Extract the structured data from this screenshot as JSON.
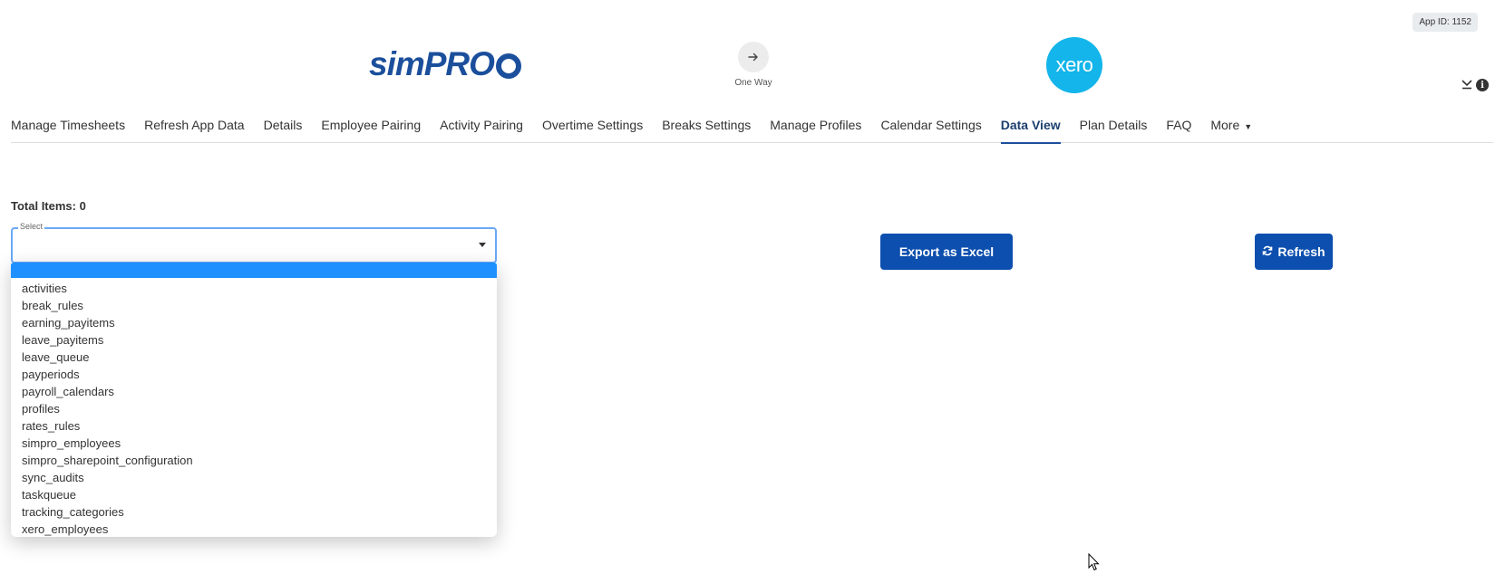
{
  "header": {
    "app_id": "App ID: 1152",
    "source_logo": "simPRO",
    "sync_direction_icon": "arrow-right-icon",
    "sync_direction_label": "One Way",
    "target_logo": "xero"
  },
  "corner_icons": [
    "collapse-icon",
    "info-icon"
  ],
  "nav": {
    "items": [
      {
        "label": "Manage Timesheets"
      },
      {
        "label": "Refresh App Data"
      },
      {
        "label": "Details"
      },
      {
        "label": "Employee Pairing"
      },
      {
        "label": "Activity Pairing"
      },
      {
        "label": "Overtime Settings"
      },
      {
        "label": "Breaks Settings"
      },
      {
        "label": "Manage Profiles"
      },
      {
        "label": "Calendar Settings"
      },
      {
        "label": "Data View"
      },
      {
        "label": "Plan Details"
      },
      {
        "label": "FAQ"
      },
      {
        "label": "More"
      }
    ],
    "active": "Data View"
  },
  "main": {
    "total_items": "Total Items: 0",
    "select": {
      "legend": "Select",
      "value": "",
      "options": [
        "activities",
        "break_rules",
        "earning_payitems",
        "leave_payitems",
        "leave_queue",
        "payperiods",
        "payroll_calendars",
        "profiles",
        "rates_rules",
        "simpro_employees",
        "simpro_sharepoint_configuration",
        "sync_audits",
        "taskqueue",
        "tracking_categories",
        "xero_employees"
      ]
    },
    "export_label": "Export as Excel",
    "refresh_label": "Refresh"
  },
  "colors": {
    "primary_button": "#0d4fae",
    "simpro_blue": "#1b4f9c",
    "xero_blue": "#13b5ea",
    "dropdown_highlight": "#1e90ff",
    "select_focus_border": "#6aa8f7"
  }
}
